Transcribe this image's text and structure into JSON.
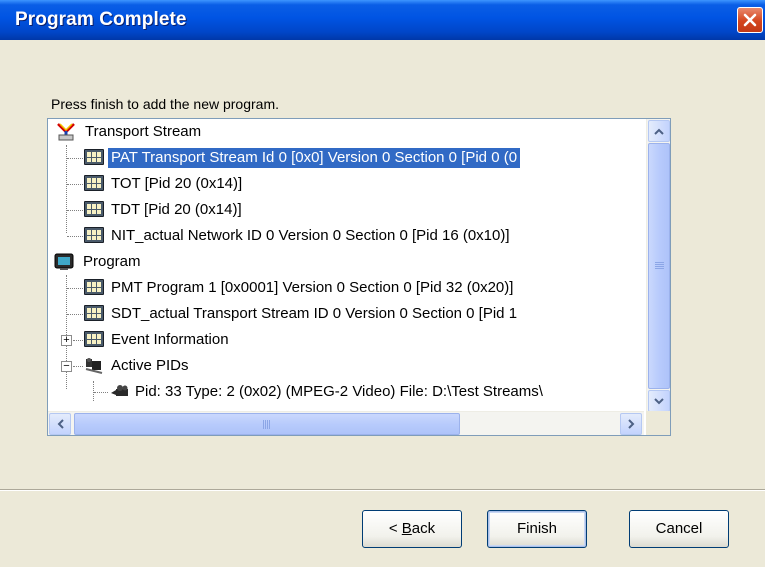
{
  "window": {
    "title": "Program Complete",
    "close_icon": "close-icon"
  },
  "instruction": "Press finish to add the new program.",
  "tree": {
    "items": [
      {
        "label": "Transport Stream",
        "icon": "transport-stream-icon",
        "level": 0
      },
      {
        "label": "PAT Transport Stream Id     0 [0x0] Version   0 Section   0 [Pid 0 (0",
        "icon": "table-icon",
        "level": 1,
        "selected": true
      },
      {
        "label": "TOT [Pid   20 (0x14)]",
        "icon": "table-icon",
        "level": 1
      },
      {
        "label": "TDT [Pid   20 (0x14)]",
        "icon": "table-icon",
        "level": 1
      },
      {
        "label": "NIT_actual Network ID     0 Version   0 Section   0 [Pid 16 (0x10)]",
        "icon": "table-icon",
        "level": 1
      },
      {
        "label": "Program",
        "icon": "program-icon",
        "level": 0
      },
      {
        "label": "PMT Program     1 [0x0001] Version   0 Section   0 [Pid 32 (0x20)]",
        "icon": "table-icon",
        "level": 1
      },
      {
        "label": "SDT_actual Transport Stream ID     0 Version   0 Section   0 [Pid 1",
        "icon": "table-icon",
        "level": 1
      },
      {
        "label": "Event Information",
        "icon": "table-icon",
        "level": 1,
        "expander": "+"
      },
      {
        "label": "Active PIDs",
        "icon": "active-pids-icon",
        "level": 1,
        "expander": "−"
      },
      {
        "label": "Pid: 33 Type: 2 (0x02) (MPEG-2 Video) File: D:\\Test Streams\\",
        "icon": "video-pid-icon",
        "level": 2
      }
    ]
  },
  "buttons": {
    "back": "Back",
    "back_mnemonic": "B",
    "back_prefix": "< ",
    "back_rest": "ack",
    "finish": "Finish",
    "cancel": "Cancel"
  },
  "colors": {
    "selection": "#316ac5",
    "titlebar": "#0054e3",
    "dialog_bg": "#ece9d8"
  }
}
